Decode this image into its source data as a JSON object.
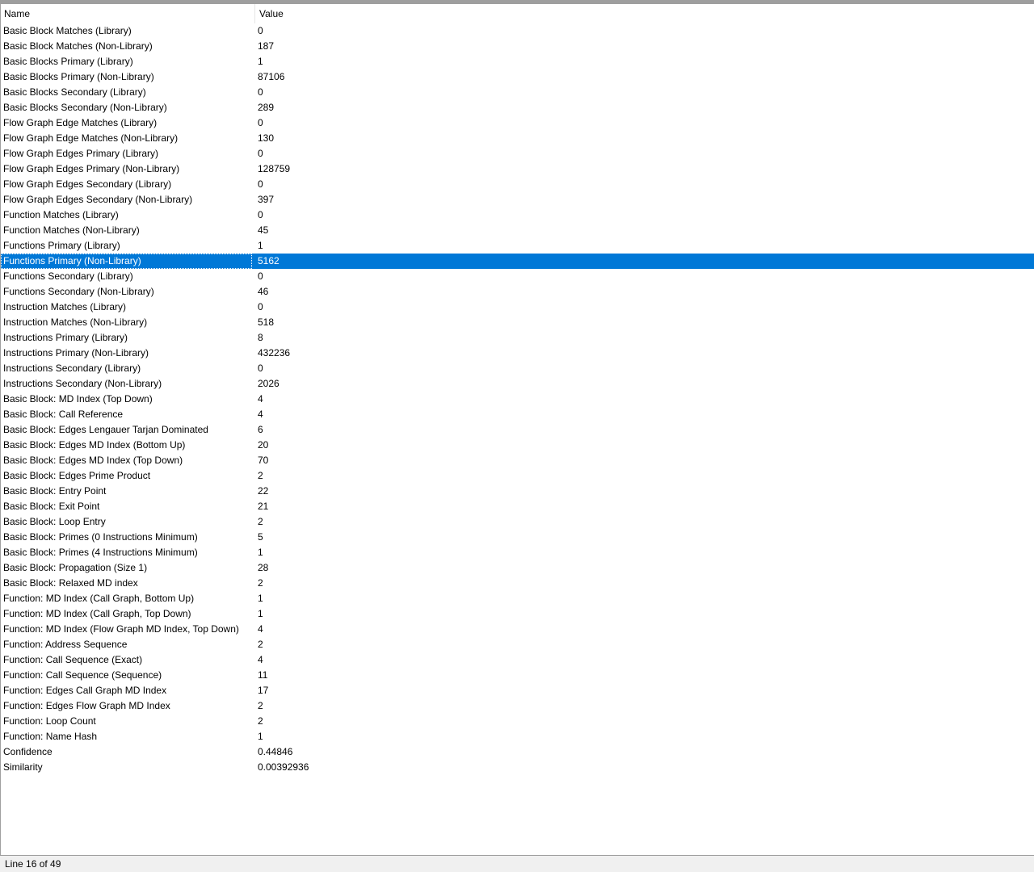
{
  "list": {
    "columns": {
      "name": "Name",
      "value": "Value"
    },
    "selected_index": 15,
    "rows": [
      {
        "name": "Basic Block Matches (Library)",
        "value": "0"
      },
      {
        "name": "Basic Block Matches (Non-Library)",
        "value": "187"
      },
      {
        "name": "Basic Blocks Primary (Library)",
        "value": "1"
      },
      {
        "name": "Basic Blocks Primary (Non-Library)",
        "value": "87106"
      },
      {
        "name": "Basic Blocks Secondary (Library)",
        "value": "0"
      },
      {
        "name": "Basic Blocks Secondary (Non-Library)",
        "value": "289"
      },
      {
        "name": "Flow Graph Edge Matches (Library)",
        "value": "0"
      },
      {
        "name": "Flow Graph Edge Matches (Non-Library)",
        "value": "130"
      },
      {
        "name": "Flow Graph Edges Primary (Library)",
        "value": "0"
      },
      {
        "name": "Flow Graph Edges Primary (Non-Library)",
        "value": "128759"
      },
      {
        "name": "Flow Graph Edges Secondary (Library)",
        "value": "0"
      },
      {
        "name": "Flow Graph Edges Secondary (Non-Library)",
        "value": "397"
      },
      {
        "name": "Function Matches (Library)",
        "value": "0"
      },
      {
        "name": "Function Matches (Non-Library)",
        "value": "45"
      },
      {
        "name": "Functions Primary (Library)",
        "value": "1"
      },
      {
        "name": "Functions Primary (Non-Library)",
        "value": "5162"
      },
      {
        "name": "Functions Secondary (Library)",
        "value": "0"
      },
      {
        "name": "Functions Secondary (Non-Library)",
        "value": "46"
      },
      {
        "name": "Instruction Matches (Library)",
        "value": "0"
      },
      {
        "name": "Instruction Matches (Non-Library)",
        "value": "518"
      },
      {
        "name": "Instructions Primary (Library)",
        "value": "8"
      },
      {
        "name": "Instructions Primary (Non-Library)",
        "value": "432236"
      },
      {
        "name": "Instructions Secondary (Library)",
        "value": "0"
      },
      {
        "name": "Instructions Secondary (Non-Library)",
        "value": "2026"
      },
      {
        "name": "Basic Block: MD Index (Top Down)",
        "value": "4"
      },
      {
        "name": "Basic Block: Call Reference",
        "value": "4"
      },
      {
        "name": "Basic Block: Edges Lengauer Tarjan Dominated",
        "value": "6"
      },
      {
        "name": "Basic Block: Edges MD Index (Bottom Up)",
        "value": "20"
      },
      {
        "name": "Basic Block: Edges MD Index (Top Down)",
        "value": "70"
      },
      {
        "name": "Basic Block: Edges Prime Product",
        "value": "2"
      },
      {
        "name": "Basic Block: Entry Point",
        "value": "22"
      },
      {
        "name": "Basic Block: Exit Point",
        "value": "21"
      },
      {
        "name": "Basic Block: Loop Entry",
        "value": "2"
      },
      {
        "name": "Basic Block: Primes (0 Instructions Minimum)",
        "value": "5"
      },
      {
        "name": "Basic Block: Primes (4 Instructions Minimum)",
        "value": "1"
      },
      {
        "name": "Basic Block: Propagation (Size 1)",
        "value": "28"
      },
      {
        "name": "Basic Block: Relaxed MD index",
        "value": "2"
      },
      {
        "name": "Function: MD Index (Call Graph, Bottom Up)",
        "value": "1"
      },
      {
        "name": "Function: MD Index (Call Graph, Top Down)",
        "value": "1"
      },
      {
        "name": "Function: MD Index (Flow Graph MD Index, Top Down)",
        "value": "4"
      },
      {
        "name": "Function: Address Sequence",
        "value": "2"
      },
      {
        "name": "Function: Call Sequence (Exact)",
        "value": "4"
      },
      {
        "name": "Function: Call Sequence (Sequence)",
        "value": "11"
      },
      {
        "name": "Function: Edges Call Graph MD Index",
        "value": "17"
      },
      {
        "name": "Function: Edges Flow Graph MD Index",
        "value": "2"
      },
      {
        "name": "Function: Loop Count",
        "value": "2"
      },
      {
        "name": "Function: Name Hash",
        "value": "1"
      },
      {
        "name": "Confidence",
        "value": "0.44846"
      },
      {
        "name": "Similarity",
        "value": "0.00392936"
      }
    ]
  },
  "status_bar": {
    "text": "Line 16 of 49"
  },
  "colors": {
    "selection": "#0078d7",
    "selection_text": "#ffffff",
    "border": "#a0a0a0",
    "status_bg": "#f0f0f0"
  }
}
